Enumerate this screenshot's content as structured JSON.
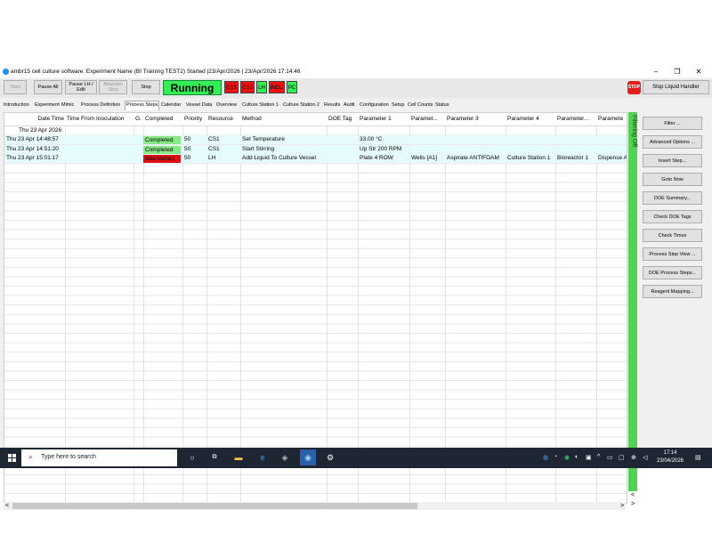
{
  "window": {
    "title": "ambr15 cell culture software: Experiment Name (BI Training TEST2) Started |23/Apr/2026 | 23/Apr/2026 17:14:46",
    "minimize": "–",
    "maximize": "❐",
    "close": "✕"
  },
  "toolbar": {
    "start": "Start",
    "pause_all": "Pause All",
    "pause_lh_edit": "Pause LH / Edit",
    "abandon_step": "Abandon Step",
    "stop": "Stop",
    "status": "Running",
    "indicators": [
      {
        "label": "CS1",
        "color": "#ee1111"
      },
      {
        "label": "CS2",
        "color": "#ee1111"
      },
      {
        "label": "LH",
        "color": "#33ee55"
      },
      {
        "label": "INCU",
        "color": "#ee1111"
      },
      {
        "label": "PC",
        "color": "#33ee55"
      }
    ],
    "stop_sign": "STOP",
    "stop_liquid_handler": "Stop Liquid Handler"
  },
  "tabs": [
    "Introduction",
    "Experiment",
    "Mimic",
    "Process Definition",
    "Process Steps",
    "Calendar",
    "Vessel Data",
    "Overview",
    "Culture Station 1",
    "Culture Station 2",
    "Results",
    "Audit",
    "Configuration",
    "Setup",
    "Cell Counts",
    "Status"
  ],
  "active_tab": "Process Steps",
  "table": {
    "columns": [
      "Date Time",
      "Time From Inoculation",
      "G.",
      "Completed",
      "Priority",
      "Resource",
      "Method",
      "DOE Tag",
      "Parameter 1",
      "Paramet...",
      "Parameter 3",
      "Parameter 4",
      "Parameter...",
      "Paramete"
    ],
    "group_header": "Thu 23 Apr 2026",
    "rows": [
      {
        "date_time": "Thu 23 Apr 14:48:57",
        "tfi": "",
        "g": "",
        "completed": "Completed",
        "priority": "50",
        "resource": "CS1",
        "method": "Set Temperature",
        "doe": "",
        "p1": "33.00 °C",
        "p2": "",
        "p3": "",
        "p4": "",
        "p5": "",
        "p6": ""
      },
      {
        "date_time": "Thu 23 Apr 14:51:20",
        "tfi": "",
        "g": "",
        "completed": "Completed",
        "priority": "50",
        "resource": "CS1",
        "method": "Start Stirring",
        "doe": "",
        "p1": "Up Str 200 RPM",
        "p2": "",
        "p3": "",
        "p4": "",
        "p5": "",
        "p6": ""
      },
      {
        "date_time": "Thu 23 Apr 15:01:17",
        "tfi": "",
        "g": "",
        "completed": "Abandoned",
        "priority": "50",
        "resource": "LH",
        "method": "Add Liquid To Culture Vessel",
        "doe": "",
        "p1": "Plate 4 ROW",
        "p2": "Wells [A1]",
        "p3": "Aspirate ANTIFOAM",
        "p4": "Culture Station 1",
        "p5": "Bioreactor 1",
        "p6": "Dispense A"
      }
    ],
    "status_colors": {
      "Completed": "#88e888",
      "Abandoned": "#dd1111"
    }
  },
  "filter_label": "Filtering Off",
  "side_buttons": [
    "Filter ...",
    "Advanced Options ...",
    "Insert Step...",
    "Goto Now",
    "DOE Summary...",
    "Check DOE Tags",
    "Check Times",
    "Process Step View ...",
    "DOE Process Steps...",
    "Reagent Mapping..."
  ],
  "scroll": {
    "left": "<",
    "right": ">",
    "up": "<",
    "down": ">"
  },
  "taskbar": {
    "search_placeholder": "Type here to search",
    "time": "17:14",
    "date": "23/04/2026"
  }
}
